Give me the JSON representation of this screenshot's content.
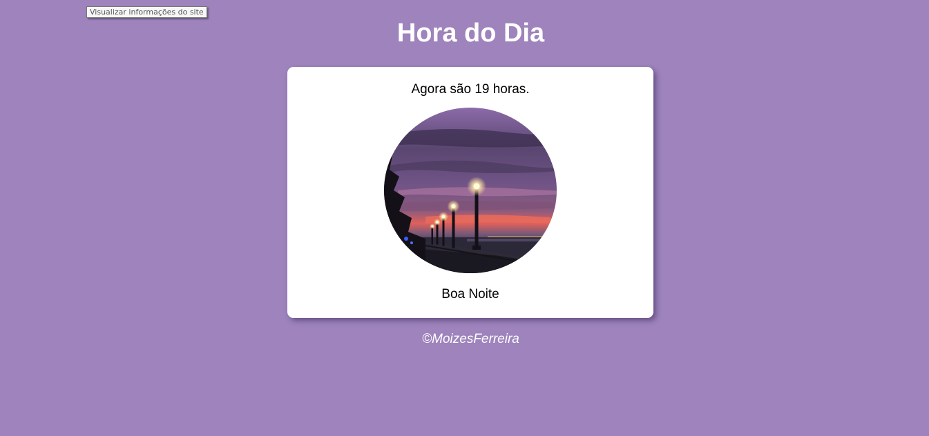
{
  "tooltip": {
    "text": "Visualizar informações do site"
  },
  "header": {
    "title": "Hora do Dia"
  },
  "card": {
    "message": "Agora são 19 horas.",
    "image_subject": "night-promenade-photo",
    "greeting": "Boa Noite"
  },
  "footer": {
    "credit": "©MoizesFerreira"
  },
  "colors": {
    "background": "#9e83bc",
    "card": "#ffffff",
    "title": "#ffffff"
  }
}
